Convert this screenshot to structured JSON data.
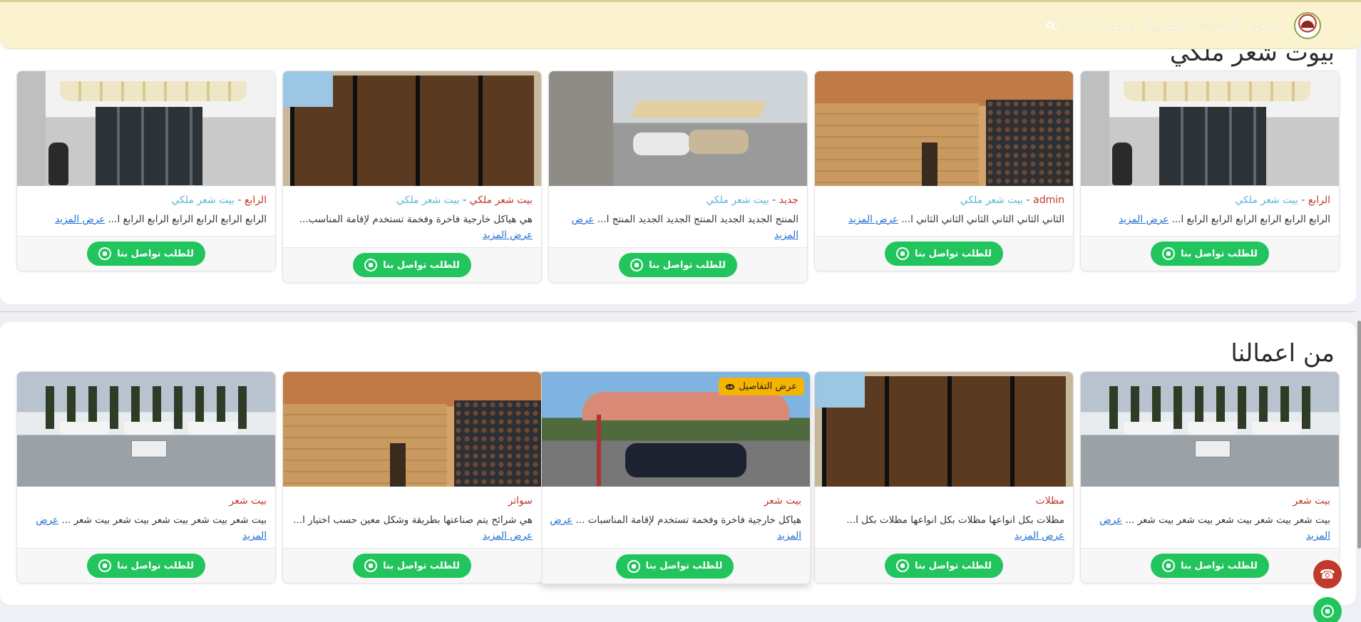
{
  "nav": {
    "items": [
      "من نحن",
      "المنتجات",
      "المشاريع",
      "تواصل بنا"
    ],
    "search_label": "بحث"
  },
  "sections": [
    {
      "title": "بيوت شعر ملكي",
      "cards": [
        {
          "cat": "الرابع",
          "parent": "بيت شعر ملكي",
          "desc": "الرابع الرابع الرابع الرابع الرابع الرابع ا...",
          "more": "عرض المزيد",
          "btn": "للطلب تواصل بنا"
        },
        {
          "cat": "admin",
          "parent": "بيت شعر ملكي",
          "desc": "الثاني الثاني الثاني الثاني الثاني الثاني ا...",
          "more": "عرض المزيد",
          "btn": "للطلب تواصل بنا"
        },
        {
          "cat": "جديد",
          "parent": "بيت شعر ملكي",
          "desc": "المنتج الجديد الجديد المنتج الجديد الجديد المنتج ا...",
          "more": "عرض المزيد",
          "btn": "للطلب تواصل بنا"
        },
        {
          "cat": "بيت شعر ملكي",
          "parent": "بيت شعر ملكي",
          "desc": "هي هياكل خارجية فاخرة وفخمة تستخدم لإقامة المناسب...",
          "more": "عرض المزيد",
          "btn": "للطلب تواصل بنا"
        },
        {
          "cat": "الرابع",
          "parent": "بيت شعر ملكي",
          "desc": "الرابع الرابع الرابع الرابع الرابع الرابع ا...",
          "more": "عرض المزيد",
          "btn": "للطلب تواصل بنا"
        }
      ]
    },
    {
      "title": "من اعمالنا",
      "cards": [
        {
          "cat": "بيت شعر",
          "desc": "بيت شعر بيت شعر بيت شعر بيت شعر بيت شعر ...",
          "more": "عرض المزيد",
          "btn": "للطلب تواصل بنا"
        },
        {
          "cat": "مظلات",
          "desc": "مظلات بكل انواعها مظلات بكل انواعها مظلات بكل ا...",
          "more": "عرض المزيد",
          "btn": "للطلب تواصل بنا"
        },
        {
          "cat": "بيت شعر",
          "desc": "هياكل خارجية فاخرة وفخمة تستخدم لإقامة المناسبات ...",
          "more": "عرض المزيد",
          "btn": "للطلب تواصل بنا",
          "badge": "عرض التفاصيل"
        },
        {
          "cat": "سواتر",
          "desc": "هي شرائح يتم صناعتها بطريقة وشكل معين حسب اختيار ا...",
          "more": "عرض المزيد",
          "btn": "للطلب تواصل بنا"
        },
        {
          "cat": "بيت شعر",
          "desc": "بيت شعر بيت شعر بيت شعر بيت شعر بيت شعر ...",
          "more": "عرض المزيد",
          "btn": "للطلب تواصل بنا"
        }
      ]
    }
  ],
  "colors": {
    "accent": "#c0392b",
    "parent_link": "#5bb6d6",
    "whatsapp": "#21c45d",
    "badge": "#f5b400",
    "navbar": "#fbf3cf"
  },
  "icons": [
    "search-icon",
    "whatsapp-icon",
    "phone-icon",
    "eye-icon"
  ]
}
